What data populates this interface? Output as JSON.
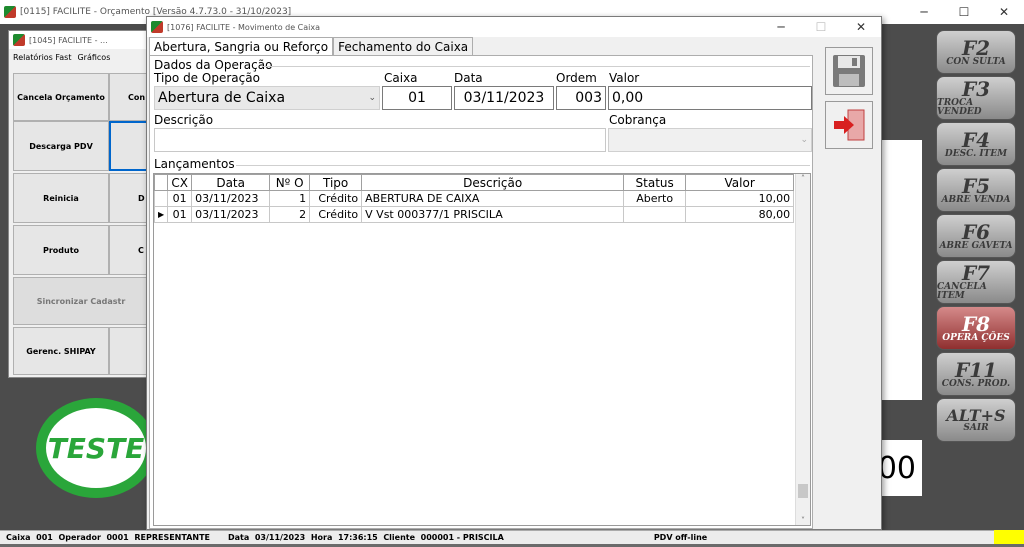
{
  "bg_window": {
    "title": "[0115] FACILITE - Orçamento [Versão 4.7.73.0 - 31/10/2023]",
    "controls": [
      "─",
      "☐",
      "✕"
    ]
  },
  "mid_window": {
    "title": "[1045] FACILITE - ...",
    "menu": [
      "Relatórios Fast",
      "Gráficos"
    ],
    "buttons": [
      "Cancela Orçamento",
      "Con",
      "Descarga PDV",
      "Reinicia",
      "D",
      "Produto",
      "C",
      "Sincronizar Cadastr",
      "Gerenc. SHIPAY"
    ]
  },
  "main_window": {
    "title": "[1076] FACILITE - Movimento de Caixa",
    "controls": [
      "─",
      "☐",
      "✕"
    ],
    "tabs": [
      "Abertura, Sangria ou Reforço",
      "Fechamento do Caixa"
    ],
    "group_title": "Dados da Operação",
    "labels": {
      "tipo": "Tipo de Operação",
      "caixa": "Caixa",
      "data": "Data",
      "ordem": "Ordem",
      "valor": "Valor",
      "descricao": "Descrição",
      "cobranca": "Cobrança"
    },
    "fields": {
      "tipo": "Abertura de Caixa",
      "caixa": "01",
      "data": "03/11/2023",
      "ordem": "003",
      "valor": "0,00",
      "descricao": "",
      "cobranca": ""
    },
    "lancamentos_title": "Lançamentos",
    "grid": {
      "columns": [
        "CX",
        "Data",
        "Nº O",
        "Tipo",
        "Descrição",
        "Status",
        "Valor"
      ],
      "rows": [
        [
          "01",
          "03/11/2023",
          "1",
          "Crédito",
          "ABERTURA DE CAIXA",
          "Aberto",
          "10,00"
        ],
        [
          "01",
          "03/11/2023",
          "2",
          "Crédito",
          "V Vst 000377/1 PRISCILA",
          "",
          "80,00"
        ]
      ]
    }
  },
  "fkeys": [
    {
      "key": "F2",
      "label": "CON SULTA"
    },
    {
      "key": "F3",
      "label": "TROCA VENDED"
    },
    {
      "key": "F4",
      "label": "DESC. ITEM"
    },
    {
      "key": "F5",
      "label": "ABRE VENDA"
    },
    {
      "key": "F6",
      "label": "ABRE GAVETA"
    },
    {
      "key": "F7",
      "label": "CANCELA ITEM"
    },
    {
      "key": "F8",
      "label": "OPERA ÇÕES"
    },
    {
      "key": "F11",
      "label": "CONS. PROD."
    },
    {
      "key": "ALT+S",
      "label": "SAIR"
    }
  ],
  "right_display": "00",
  "stamp_text": "TESTE",
  "status_bar": {
    "caixa_label": "Caixa",
    "caixa": "001",
    "operador_label": "Operador",
    "operador": "0001",
    "operador_nome": "REPRESENTANTE",
    "data_label": "Data",
    "data": "03/11/2023",
    "hora_label": "Hora",
    "hora": "17:36:15",
    "cliente_label": "Cliente",
    "cliente": "000001 - PRISCILA",
    "pdv": "PDV off-line"
  }
}
